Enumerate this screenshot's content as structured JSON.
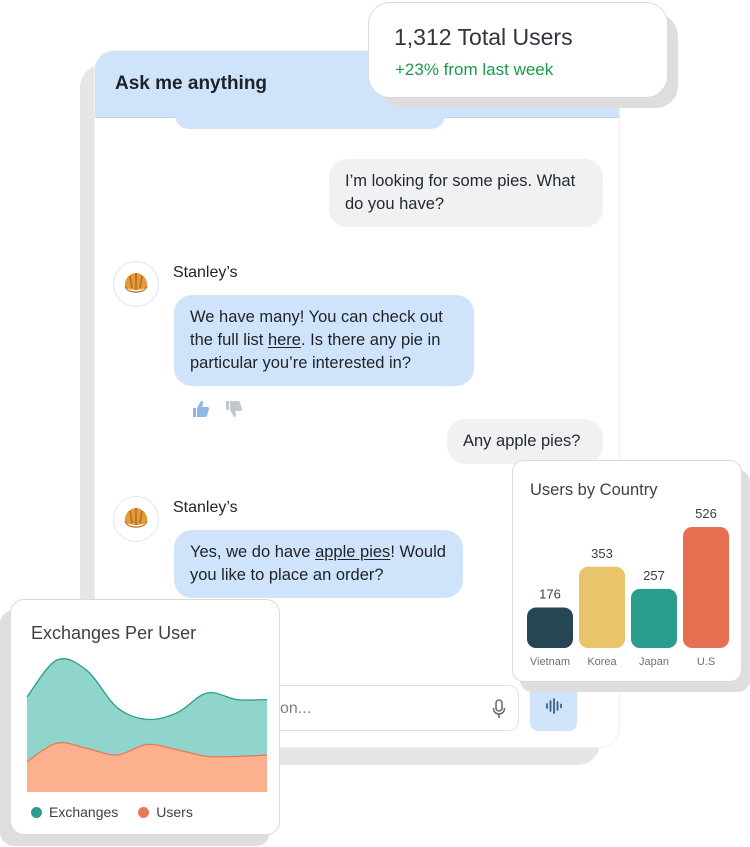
{
  "chat": {
    "title": "Ask me anything",
    "messages": [
      {
        "role": "user",
        "text": "I’m looking for some pies. What do you have?"
      },
      {
        "role": "bot",
        "sender": "Stanley’s",
        "text_before": "We have many! You can check out the full list ",
        "link": "here",
        "text_after": ". Is there any pie in particular you’re interested in?"
      },
      {
        "role": "user",
        "text": "Any apple pies?"
      },
      {
        "role": "bot",
        "sender": "Stanley’s",
        "text_before": "Yes, we do have ",
        "link": "apple pies",
        "text_after": "! Would you like to place an order?"
      }
    ],
    "composer_placeholder_visible": "on...",
    "avatar_icon": "croissant-icon"
  },
  "stats": {
    "total_users": "1,312 Total Users",
    "delta": "+23% from last week",
    "delta_color": "#1b9a4b"
  },
  "chart_data": [
    {
      "type": "bar",
      "title": "Users by Country",
      "categories": [
        "Vietnam",
        "Korea",
        "Japan",
        "U.S"
      ],
      "values": [
        176,
        353,
        257,
        526
      ],
      "colors": [
        "#264653",
        "#e9c46a",
        "#2a9d8f",
        "#e76f51"
      ],
      "ylim": [
        0,
        526
      ]
    },
    {
      "type": "area",
      "title": "Exchanges Per User",
      "x": [
        0,
        1,
        2,
        3,
        4,
        5,
        6,
        7,
        8
      ],
      "series": [
        {
          "name": "Exchanges",
          "color": "#2a9d8f",
          "values": [
            0.72,
            1.0,
            0.92,
            0.64,
            0.55,
            0.6,
            0.75,
            0.7,
            0.7
          ]
        },
        {
          "name": "Users",
          "color": "#f4a261",
          "values": [
            0.23,
            0.37,
            0.33,
            0.28,
            0.36,
            0.32,
            0.27,
            0.27,
            0.28
          ]
        }
      ]
    }
  ]
}
